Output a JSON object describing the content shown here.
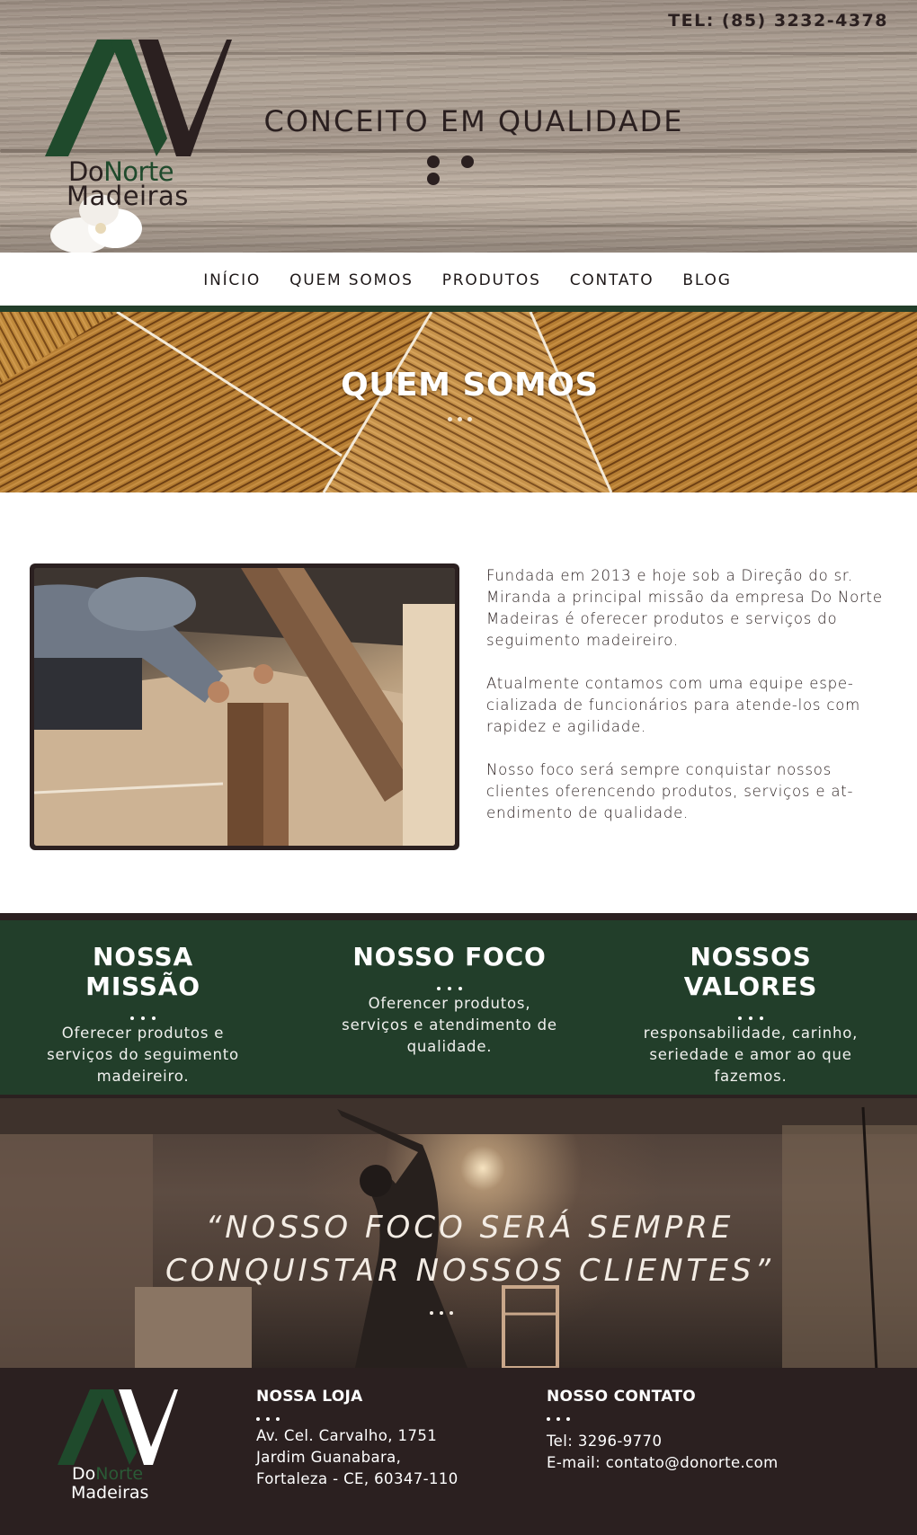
{
  "header": {
    "phone": "TEL: (85) 3232-4378",
    "tagline": "CONCEITO EM QUALIDADE",
    "logo": {
      "line1_a": "Do",
      "line1_b": "Norte",
      "line2": "Madeiras"
    }
  },
  "nav": {
    "items": [
      {
        "label": "INÍCIO"
      },
      {
        "label": "QUEM SOMOS"
      },
      {
        "label": "PRODUTOS"
      },
      {
        "label": "CONTATO"
      },
      {
        "label": "BLOG"
      }
    ]
  },
  "banner": {
    "title": "QUEM SOMOS"
  },
  "about": {
    "paragraphs": [
      "Fundada em 2013 e hoje sob a Direção do sr. Miranda a principal missão da empresa Do Norte Madeiras é oferecer produtos e serviços do seguimento madeireiro.",
      "Atualmente contamos com uma equipe espe-cializada de funcionários para atende-los com rapidez e agilidade.",
      "Nosso foco será sempre conquistar nossos clientes oferencendo produtos, serviços e at-endimento de qualidade."
    ]
  },
  "columns": [
    {
      "title": "NOSSA MISSÃO",
      "text": "Oferecer produtos e serviços do seguimento madeireiro."
    },
    {
      "title": "NOSSO FOCO",
      "text": "Oferencer produtos, serviços e atendimento de qualidade."
    },
    {
      "title": "NOSSOS VALORES",
      "text": "responsabilidade, carinho, seriedade e amor ao que fazemos."
    }
  ],
  "quote": {
    "line1": "“NOSSO FOCO SERÁ SEMPRE",
    "line2": "CONQUISTAR NOSSOS CLIENTES”"
  },
  "footer": {
    "logo": {
      "line1_a": "Do",
      "line1_b": "Norte",
      "line2": "Madeiras"
    },
    "store": {
      "title": "NOSSA LOJA",
      "lines": [
        "Av. Cel. Carvalho, 1751",
        "Jardim Guanabara,",
        "Fortaleza - CE, 60347-110"
      ]
    },
    "contact": {
      "title": "NOSSO CONTATO",
      "lines": [
        "Tel: 3296-9770",
        "E-mail: contato@donorte.com"
      ]
    }
  },
  "colors": {
    "brand_dark": "#2b2020",
    "brand_green": "#223e2a",
    "wood": "#b47c32"
  }
}
